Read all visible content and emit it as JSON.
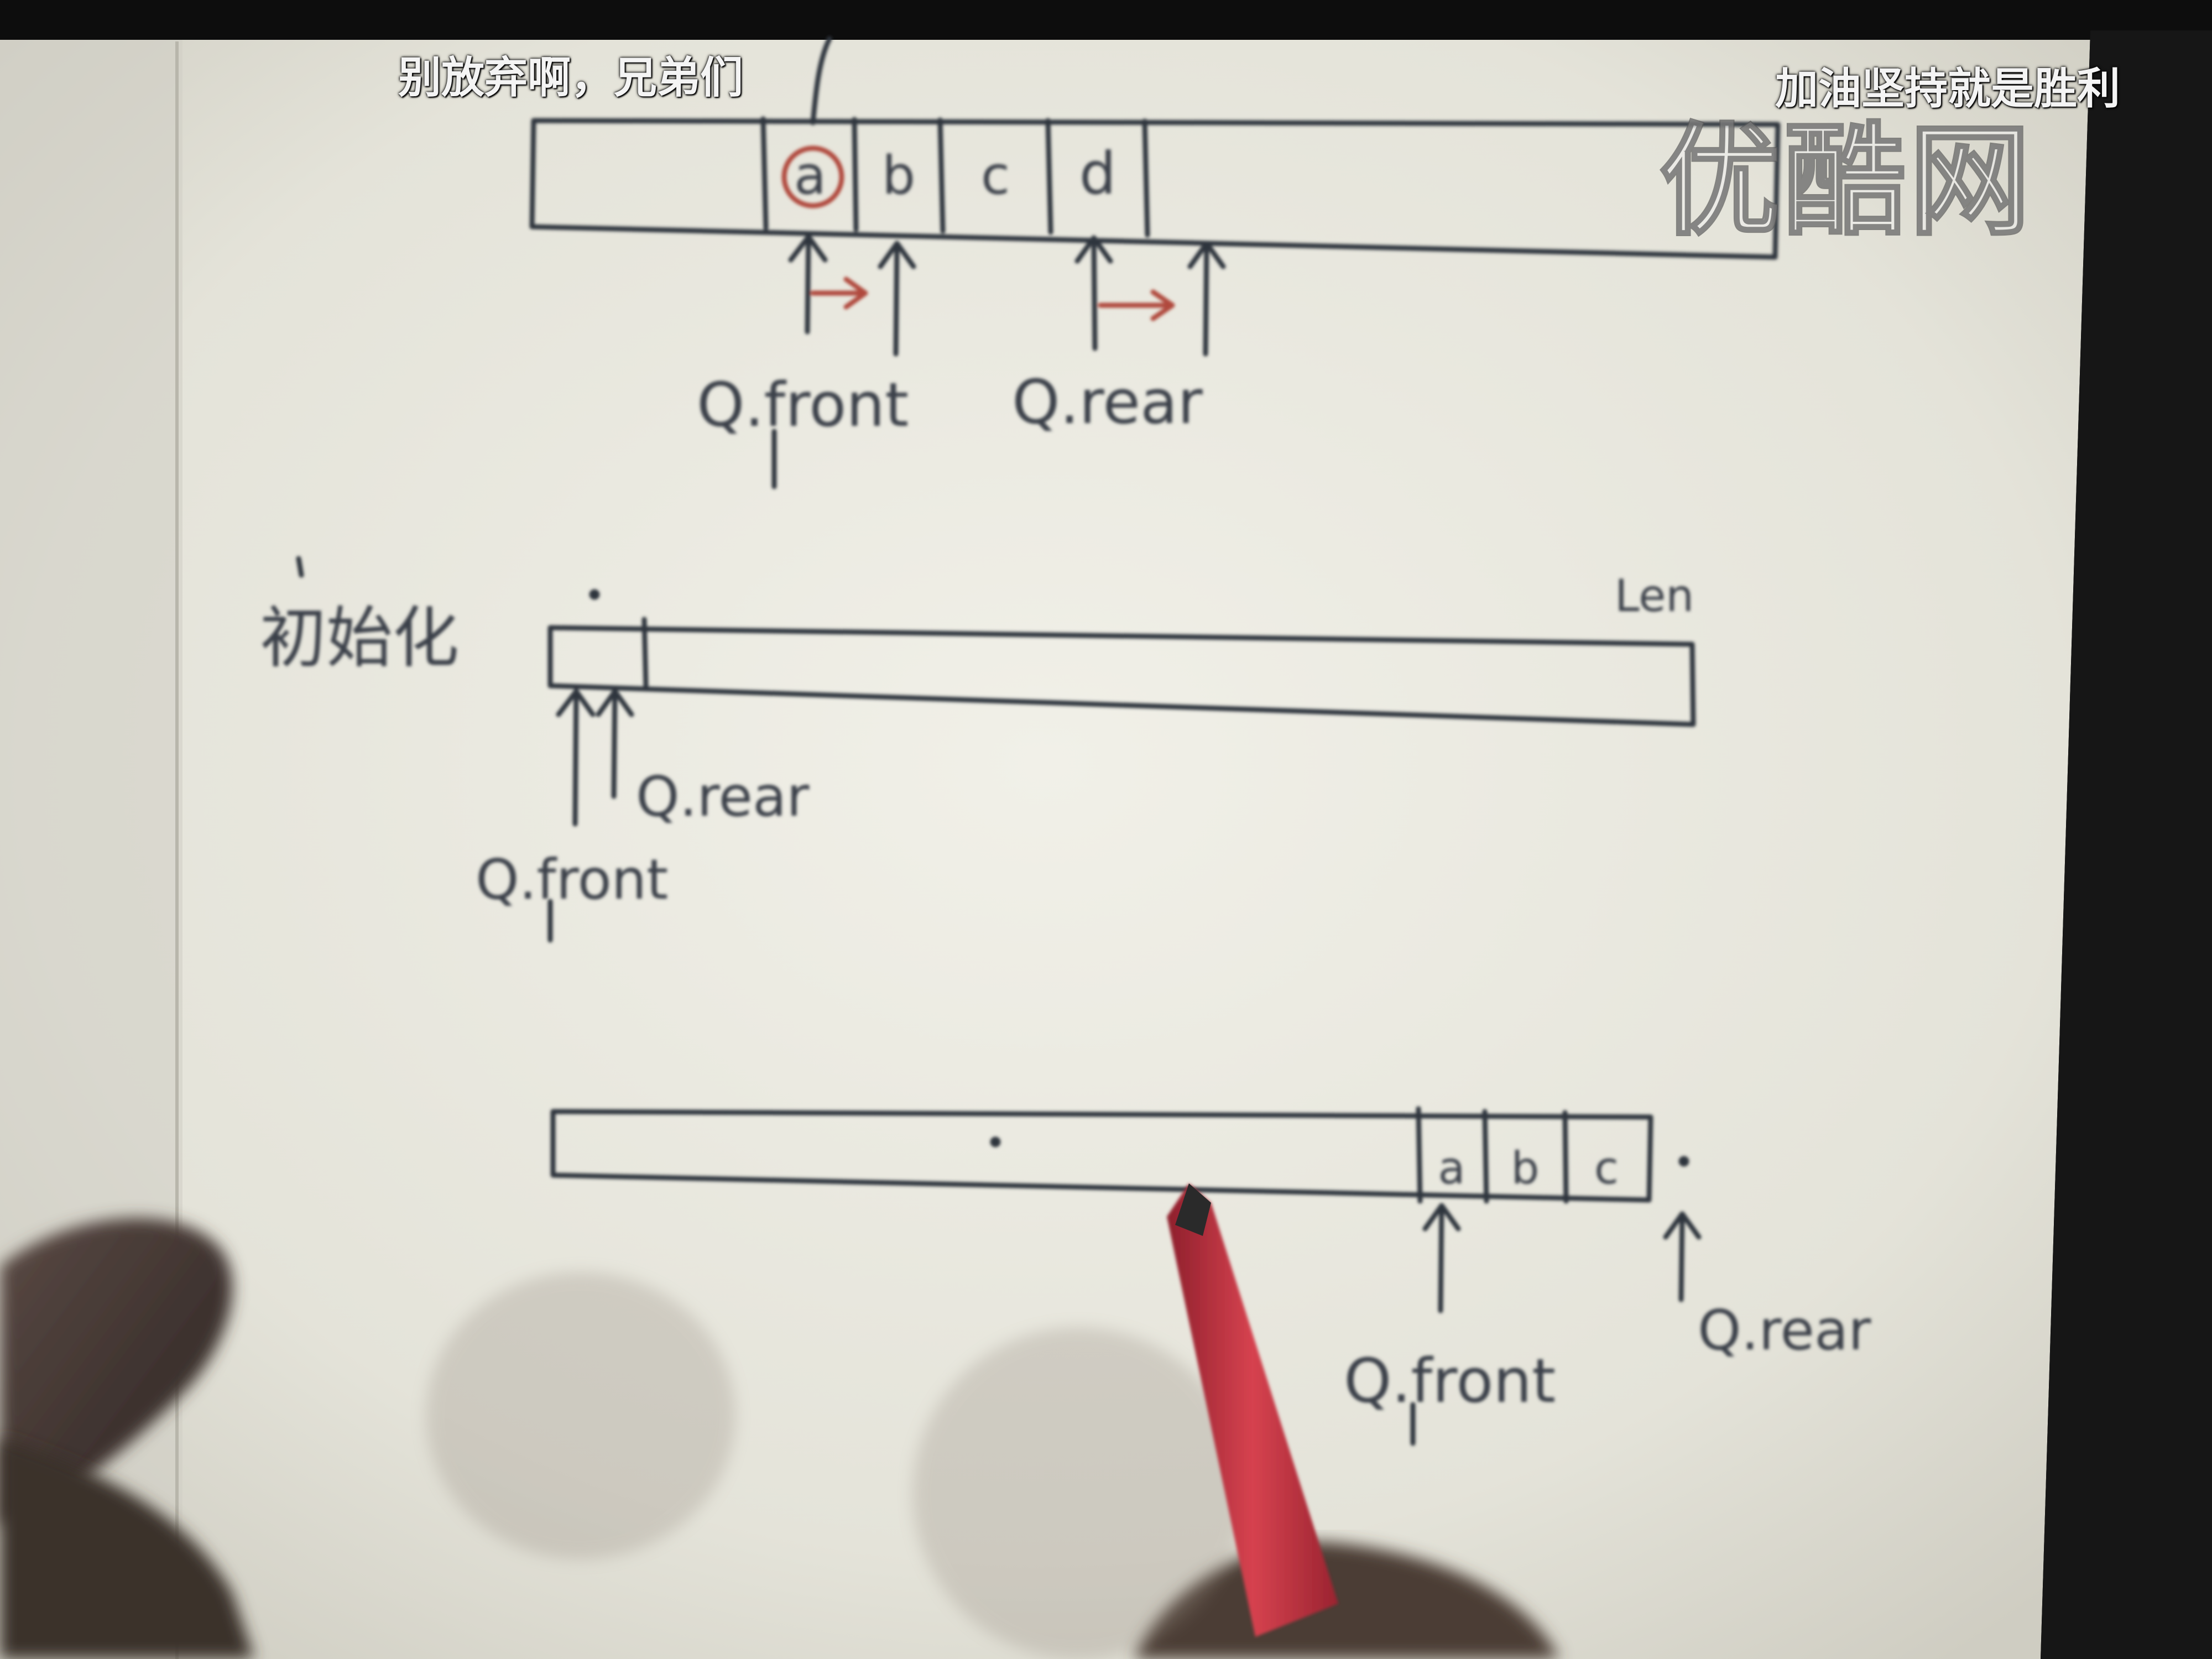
{
  "overlay": {
    "subtitle_left": "别放弃啊，兄弟们",
    "subtitle_right": "加油坚持就是胜利",
    "watermark_logo": "优酷网"
  },
  "diagram_top": {
    "cells": [
      "a",
      "b",
      "c",
      "d"
    ],
    "front_label": "Q.front",
    "rear_label": "Q.rear"
  },
  "diagram_middle": {
    "label_init": "初始化",
    "size_label": "Len",
    "front_label": "Q.front",
    "rear_label": "Q.rear"
  },
  "diagram_bottom": {
    "cells": [
      "a",
      "b",
      "c"
    ],
    "front_label": "Q.front",
    "rear_label": "Q.rear"
  },
  "colors": {
    "paper": "#e9e8df",
    "ink": "#2f343d",
    "red_ink": "#b04a3c",
    "pen": "#c0323e",
    "screen_border": "#111111"
  }
}
